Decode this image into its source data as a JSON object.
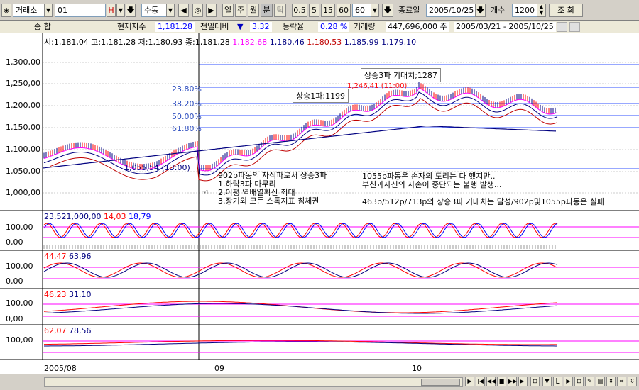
{
  "toolbar": {
    "market": "거래소",
    "code": "01",
    "h_label": "H",
    "mode": "수동",
    "periods": [
      "일",
      "주",
      "월",
      "분",
      "틱"
    ],
    "intervals": [
      "0.5",
      "5",
      "15",
      "60"
    ],
    "interval_value": "60",
    "end_date_label": "종료일",
    "end_date": "2005/10/25",
    "count_label": "개수",
    "count": "1200",
    "query_button": "조 회"
  },
  "status": {
    "name": "종   합",
    "index_label": "현재지수",
    "index_value": "1,181.28",
    "prev_label": "전일대비",
    "change": "3.32",
    "rate_label": "등락율",
    "rate": "0.28 %",
    "volume_label": "거래량",
    "volume": "447,696,000 주",
    "range": "2005/03/21 - 2005/10/25"
  },
  "price_panel": {
    "ohlc": "시:1,181,04 고:1,181,28 저:1,180,93 종:",
    "ohlc_close": "1,181,28",
    "ma_values": [
      "1,182,68",
      "1,180,46",
      "1,180,53",
      "1,185,99",
      "1,179,10"
    ],
    "y_labels": [
      "1,300,00",
      "1,250,00",
      "1,200,00",
      "1,150,00",
      "1,100,00",
      "1,050,00",
      "1,000,00"
    ],
    "fib_levels": [
      "23.80%",
      "38.20%",
      "50.00%",
      "61.80%"
    ],
    "annotation_wave3": "상승3파 기대치;1287",
    "annotation_wave1": "상승1파;1199",
    "high_label": "1,246,41 (11:00)",
    "low_label": "1,055,54 (13:00)",
    "note_left": [
      "902p파동의 자식파로서 상승3파",
      "1.하락3파 마무리",
      "2.이평 역배열확산 최대",
      "3.장기외 모든 스톡지표 침체권"
    ],
    "note_right": [
      "1055p파동은 손자의 도리는 다 했지만..",
      "부친과자신의 자손이 중단되는 불행 발생..."
    ],
    "note_bottom": "463p/512p/713p의 상승3파 기대치는 달성/902p및1055p파동은 실패"
  },
  "panel2": {
    "values": [
      "23,521,000,00",
      "14,03",
      "18,79"
    ],
    "y_labels": [
      "100,00",
      "0,00"
    ]
  },
  "panel3": {
    "values": [
      "44,47",
      "63,96"
    ],
    "y_labels": [
      "100,00",
      "0,00"
    ]
  },
  "panel4": {
    "values": [
      "46,23",
      "31,10"
    ],
    "y_labels": [
      "100,00",
      "0,00"
    ]
  },
  "panel5": {
    "values": [
      "62,07",
      "78,56"
    ],
    "y_labels": [
      "100,00"
    ]
  },
  "x_labels": [
    "2005/08",
    "09",
    "10"
  ],
  "colors": {
    "accent": "#0000ff",
    "red": "#ff0000",
    "magenta": "#ff00ff",
    "navy": "#000080"
  }
}
